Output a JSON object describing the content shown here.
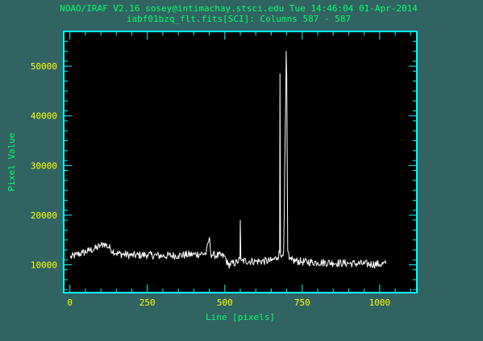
{
  "header": {
    "line1": "NOAO/IRAF V2.16 sosey@intimachay.stsci.edu Tue 14:46:04 01-Apr-2014",
    "line2": "iabf01bzq_flt.fits[SCI]: Columns 587 - 587"
  },
  "colors": {
    "window_bg": "#316363",
    "plot_bg": "#000000",
    "frame": "#00ffff",
    "tick_label": "#ffff00",
    "axis_label": "#00ff66",
    "header_text": "#00ff66",
    "data": "#ffffff"
  },
  "chart_data": {
    "type": "line",
    "title": "iabf01bzq_flt.fits[SCI]: Columns 587 - 587",
    "xlabel": "Line [pixels]",
    "ylabel": "Pixel Value",
    "xlim": [
      -20,
      1120
    ],
    "ylim": [
      4400,
      57000
    ],
    "xticks": [
      0,
      250,
      500,
      750,
      1000
    ],
    "xtick_labels": [
      "0",
      "250",
      "500",
      "750",
      "1000"
    ],
    "yticks": [
      10000,
      20000,
      30000,
      40000,
      50000
    ],
    "ytick_labels": [
      "10000",
      "20000",
      "30000",
      "40000",
      "50000"
    ],
    "grid": false,
    "series": [
      {
        "x": [
          1,
          20,
          40,
          60,
          80,
          100,
          110,
          130,
          150,
          200,
          250,
          300,
          350,
          400,
          440,
          450,
          455,
          460,
          500,
          510,
          540,
          549,
          550,
          552,
          555,
          600,
          650,
          670,
          677,
          678,
          680,
          683,
          690,
          697,
          698,
          700,
          703,
          708,
          715,
          750,
          800,
          850,
          900,
          950,
          1000,
          1020
        ],
        "y": [
          11500,
          12000,
          12400,
          12800,
          13200,
          13900,
          14300,
          13300,
          12300,
          11900,
          12000,
          11800,
          11900,
          12100,
          12300,
          15500,
          12200,
          12000,
          11700,
          10000,
          10500,
          11200,
          19000,
          11000,
          10800,
          10700,
          10800,
          11500,
          12500,
          48500,
          12000,
          11500,
          13000,
          45000,
          53000,
          48000,
          13000,
          11000,
          10900,
          10600,
          10500,
          10400,
          10300,
          10200,
          10100,
          10200
        ]
      }
    ]
  }
}
